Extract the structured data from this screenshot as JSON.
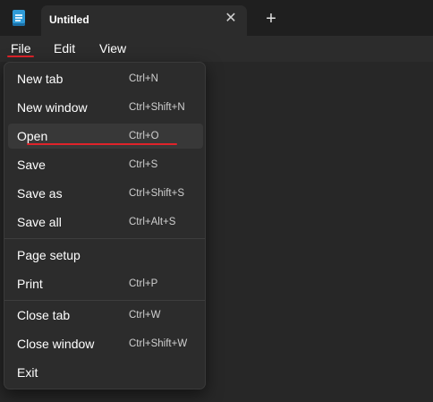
{
  "titlebar": {
    "app_icon": "notepad-icon",
    "tab": {
      "title": "Untitled",
      "close_glyph": "✕",
      "close_icon": "close-icon"
    },
    "new_tab": {
      "glyph": "+",
      "icon": "plus-icon"
    }
  },
  "menubar": {
    "items": [
      {
        "label": "File",
        "active": true
      },
      {
        "label": "Edit"
      },
      {
        "label": "View"
      }
    ]
  },
  "file_menu": {
    "groups": [
      [
        {
          "label": "New tab",
          "shortcut": "Ctrl+N"
        },
        {
          "label": "New window",
          "shortcut": "Ctrl+Shift+N"
        },
        {
          "label": "Open",
          "shortcut": "Ctrl+O",
          "highlighted": true
        },
        {
          "label": "Save",
          "shortcut": "Ctrl+S"
        },
        {
          "label": "Save as",
          "shortcut": "Ctrl+Shift+S"
        },
        {
          "label": "Save all",
          "shortcut": "Ctrl+Alt+S"
        }
      ],
      [
        {
          "label": "Page setup",
          "shortcut": ""
        },
        {
          "label": "Print",
          "shortcut": "Ctrl+P"
        }
      ],
      [
        {
          "label": "Close tab",
          "shortcut": "Ctrl+W"
        },
        {
          "label": "Close window",
          "shortcut": "Ctrl+Shift+W"
        },
        {
          "label": "Exit",
          "shortcut": ""
        }
      ]
    ]
  },
  "colors": {
    "accent_underline": "#e0232a",
    "background": "#272727",
    "menu_background": "#2c2c2c",
    "highlight": "#383838"
  }
}
